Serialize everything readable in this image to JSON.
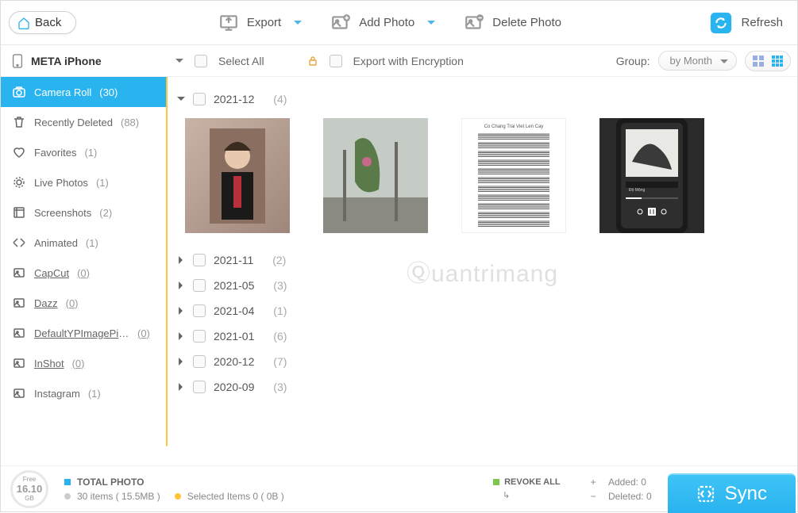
{
  "toolbar": {
    "back": "Back",
    "export": "Export",
    "add_photo": "Add Photo",
    "delete_photo": "Delete Photo",
    "refresh": "Refresh"
  },
  "device": {
    "name": "META iPhone"
  },
  "filters": {
    "select_all": "Select All",
    "export_encrypted": "Export with Encryption",
    "group_label": "Group:",
    "group_value": "by Month"
  },
  "sidebar": {
    "items": [
      {
        "label": "Camera Roll",
        "count": "(30)",
        "active": true,
        "icon": "camera"
      },
      {
        "label": "Recently Deleted",
        "count": "(88)",
        "icon": "trash"
      },
      {
        "label": "Favorites",
        "count": "(1)",
        "icon": "heart"
      },
      {
        "label": "Live Photos",
        "count": "(1)",
        "icon": "live"
      },
      {
        "label": "Screenshots",
        "count": "(2)",
        "icon": "screenshot"
      },
      {
        "label": "Animated",
        "count": "(1)",
        "icon": "animated"
      },
      {
        "label": "CapCut",
        "count": "(0)",
        "icon": "album",
        "underlined": true
      },
      {
        "label": "Dazz",
        "count": "(0)",
        "icon": "album",
        "underlined": true
      },
      {
        "label": "DefaultYPImagePic...",
        "count": "(0)",
        "icon": "album",
        "underlined": true
      },
      {
        "label": "InShot",
        "count": "(0)",
        "icon": "album",
        "underlined": true
      },
      {
        "label": "Instagram",
        "count": "(1)",
        "icon": "album"
      }
    ]
  },
  "groups": [
    {
      "label": "2021-12",
      "count": "(4)",
      "expanded": true
    },
    {
      "label": "2021-11",
      "count": "(2)"
    },
    {
      "label": "2021-05",
      "count": "(3)"
    },
    {
      "label": "2021-04",
      "count": "(1)"
    },
    {
      "label": "2021-01",
      "count": "(6)"
    },
    {
      "label": "2020-12",
      "count": "(7)"
    },
    {
      "label": "2020-09",
      "count": "(3)"
    }
  ],
  "watermark": "Ⓠuantrimang",
  "footer": {
    "storage_label": "Free",
    "storage_value": "16.10",
    "storage_unit": "GB",
    "total_label": "TOTAL PHOTO",
    "items_text": "30 items ( 15.5MB )",
    "selected_text": "Selected Items 0 ( 0B )",
    "revoke": "REVOKE ALL",
    "revoke_icon_sub": "↳",
    "added": "Added: 0",
    "deleted": "Deleted: 0",
    "sync": "Sync"
  }
}
